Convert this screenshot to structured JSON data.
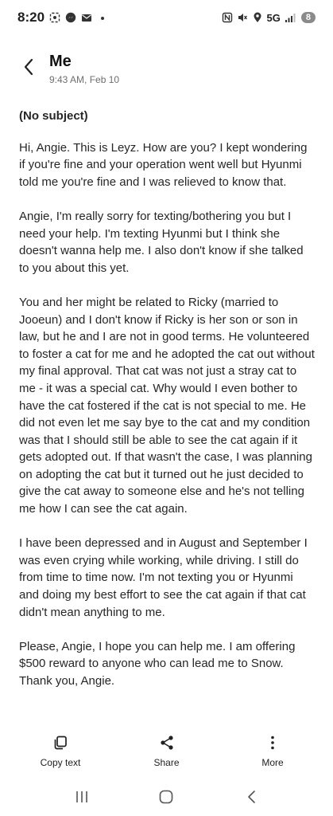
{
  "status_bar": {
    "time": "8:20",
    "network": "5G",
    "battery": "8",
    "left_icons": [
      "screenshot-icon",
      "messenger-icon",
      "email-icon",
      "dot-icon"
    ],
    "right_icons": [
      "nfc-icon",
      "mute-icon",
      "location-icon",
      "signal-icon"
    ]
  },
  "header": {
    "sender": "Me",
    "date": "9:43 AM, Feb 10"
  },
  "message": {
    "subject": "(No subject)",
    "paragraphs": [
      "Hi, Angie. This is Leyz. How are you? I kept wondering if you're fine and your operation went well but Hyunmi told me you're fine and I was relieved to know that.",
      "Angie, I'm really sorry for texting/bothering you but I need your help. I'm texting Hyunmi but I think she doesn't wanna help me. I also don't know if she talked to you about this yet.",
      "You and her might be related to Ricky (married to Jooeun) and I don't know if Ricky is her son or son in law, but he and I are not in good terms. He volunteered to foster a cat for me and he adopted the cat out without my final approval. That cat was not just a stray cat to me - it was a special cat. Why would I even bother to have the cat fostered if the cat is not special to me. He did not even let me say bye to the cat and my condition was that I should still be able to see the cat again if it gets adopted out. If that wasn't the case, I was planning on adopting the cat but it turned out he just decided to give the cat away to someone else and he's not telling me how I can see the cat again.",
      "I have been depressed and in August and September I was even crying while working, while driving. I still do from time to time now. I'm not texting you or Hyunmi and doing my best effort to see the cat again if that cat didn't mean anything to me.",
      "Please, Angie, I hope you can help me. I am offering $500 reward to anyone who can lead me to Snow. Thank you, Angie."
    ]
  },
  "actions": {
    "copy": "Copy text",
    "share": "Share",
    "more": "More"
  },
  "colors": {
    "text": "#262626",
    "muted": "#6e6e6e",
    "battery_bg": "#8a8a8a"
  }
}
